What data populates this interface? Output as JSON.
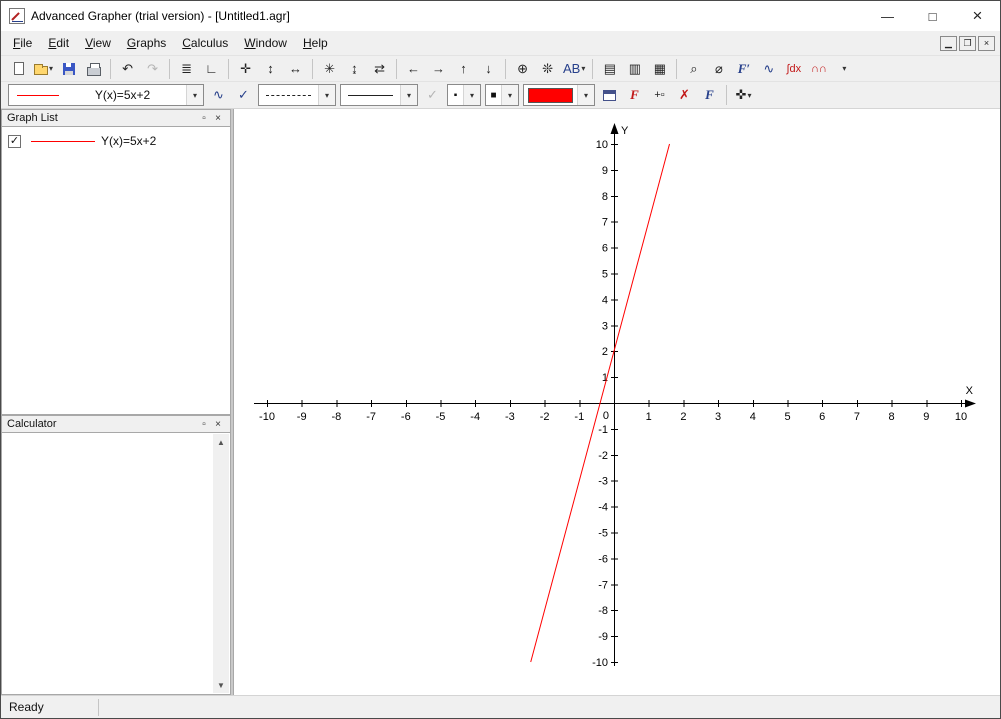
{
  "window": {
    "title": "Advanced Grapher (trial version) - [Untitled1.agr]",
    "controls": {
      "minimize": "—",
      "maximize": "□",
      "close": "×"
    }
  },
  "menu": {
    "items": [
      "File",
      "Edit",
      "View",
      "Graphs",
      "Calculus",
      "Window",
      "Help"
    ],
    "mdi": {
      "minimize": "▁",
      "restore": "❐",
      "close": "×"
    }
  },
  "icons": {
    "dropdown": "▾",
    "undo": "↶",
    "redo": "↷",
    "graph_list": "≣",
    "axes": "∟",
    "move": "✛",
    "fit_v": "↕",
    "fit_h": "↔",
    "autoscale": "✳",
    "squeeze_v": "↨",
    "squeeze_h": "⇄",
    "left": "←",
    "right": "→",
    "up": "↑",
    "down": "↓",
    "trace": "⊕",
    "snap": "❊",
    "labels": "AB",
    "table_values": "▤",
    "table_list": "▥",
    "table_grid": "▦",
    "zoom_curve": "⌕",
    "zoom_off": "⌀",
    "derivative": "F′",
    "curve": "∿",
    "integral": "∫dx",
    "distribution": "∩∩",
    "check": "✓",
    "point": "▪",
    "fill": "■",
    "add_graph": "F",
    "add_graphs": "+▫",
    "delete_graph": "✗",
    "edit_graph": "F",
    "crosshair": "✜",
    "panel_float": "▫",
    "panel_close": "×",
    "scroll_up": "▲",
    "scroll_down": "▼"
  },
  "toolbar2": {
    "formula": "Y(x)=5x+2"
  },
  "sidebar": {
    "graph_list": {
      "title": "Graph List",
      "items": [
        {
          "label": "Y(x)=5x+2",
          "checked": true,
          "color": "#ff0000"
        }
      ]
    },
    "calculator": {
      "title": "Calculator"
    }
  },
  "status": {
    "text": "Ready"
  },
  "colors": {
    "curve_red": "#ff0000",
    "icon_blue": "#27408b",
    "icon_red": "#c21818"
  },
  "chart_data": {
    "type": "line",
    "title": "",
    "equation": "Y(x)=5x+2",
    "xlabel": "X",
    "ylabel": "Y",
    "x_range": [
      -10,
      10
    ],
    "y_range": [
      -10,
      10
    ],
    "grid": false,
    "legend": "none",
    "x_ticks": [
      -10,
      -9,
      -8,
      -7,
      -6,
      -5,
      -4,
      -3,
      -2,
      -1,
      1,
      2,
      3,
      4,
      5,
      6,
      7,
      8,
      9,
      10
    ],
    "y_ticks": [
      -10,
      -9,
      -8,
      -7,
      -6,
      -5,
      -4,
      -3,
      -2,
      -1,
      1,
      2,
      3,
      4,
      5,
      6,
      7,
      8,
      9,
      10
    ],
    "origin_label": "0",
    "series": [
      {
        "name": "Y(x)=5x+2",
        "color": "#ff0000",
        "slope": 5,
        "intercept": 2,
        "points": [
          [
            -2.4,
            -10
          ],
          [
            1.6,
            10
          ]
        ]
      }
    ]
  }
}
